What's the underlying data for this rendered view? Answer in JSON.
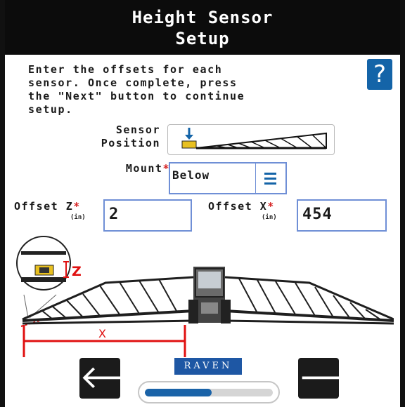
{
  "header": {
    "title_line1": "Height Sensor",
    "title_line2": "Setup"
  },
  "instructions": [
    "Enter the offsets for each",
    "sensor. Once complete, press",
    "the \"Next\" button to continue",
    "setup."
  ],
  "help": {
    "label": "?"
  },
  "sensor_position": {
    "label_line1": "Sensor",
    "label_line2": "Position"
  },
  "mount": {
    "label": "Mount",
    "value": "Below"
  },
  "offset_z": {
    "label": "Offset Z",
    "unit": "(in)",
    "value": "2"
  },
  "offset_x": {
    "label": "Offset X",
    "unit": "(in)",
    "value": "454"
  },
  "required_mark": "*",
  "diagram": {
    "z_label": "Z",
    "x_label": "X"
  },
  "nav": {
    "back_glyph": "🡐",
    "next_glyph": "🡒"
  },
  "brand": "RAVEN",
  "progress": {
    "fraction": 0.52
  },
  "colors": {
    "accent": "#1464a8",
    "required": "#d52020",
    "field_border": "#6f8fd6",
    "dimension_line": "#e01010"
  }
}
